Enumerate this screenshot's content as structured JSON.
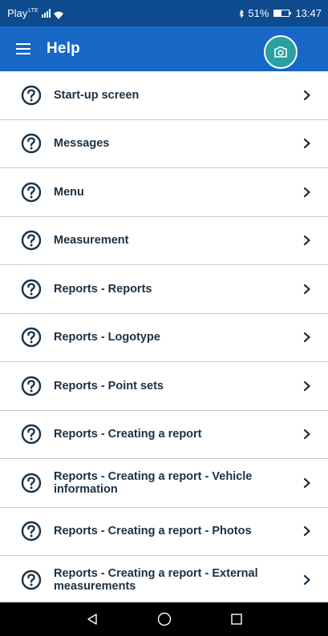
{
  "status_bar": {
    "carrier": "Play",
    "network": "LTE",
    "battery_percent": "51%",
    "time": "13:47"
  },
  "app_bar": {
    "title": "Help",
    "menu_icon": "hamburger-icon",
    "action_icon": "camera-icon"
  },
  "help_items": [
    {
      "label": "Start-up screen"
    },
    {
      "label": "Messages"
    },
    {
      "label": "Menu"
    },
    {
      "label": "Measurement"
    },
    {
      "label": "Reports - Reports"
    },
    {
      "label": "Reports - Logotype"
    },
    {
      "label": "Reports - Point sets"
    },
    {
      "label": "Reports - Creating a report"
    },
    {
      "label": "Reports - Creating a report - Vehicle information"
    },
    {
      "label": "Reports - Creating a report - Photos"
    },
    {
      "label": "Reports - Creating a report - External measurements"
    }
  ],
  "nav_bar": {
    "back_icon": "back-triangle-icon",
    "home_icon": "home-circle-icon",
    "recents_icon": "recents-square-icon"
  },
  "colors": {
    "status_bar": "#0d4a8e",
    "app_bar": "#1767c6",
    "camera_button": "#2aa0a0",
    "item_text": "#1b3144",
    "divider": "#c9c9c9"
  }
}
